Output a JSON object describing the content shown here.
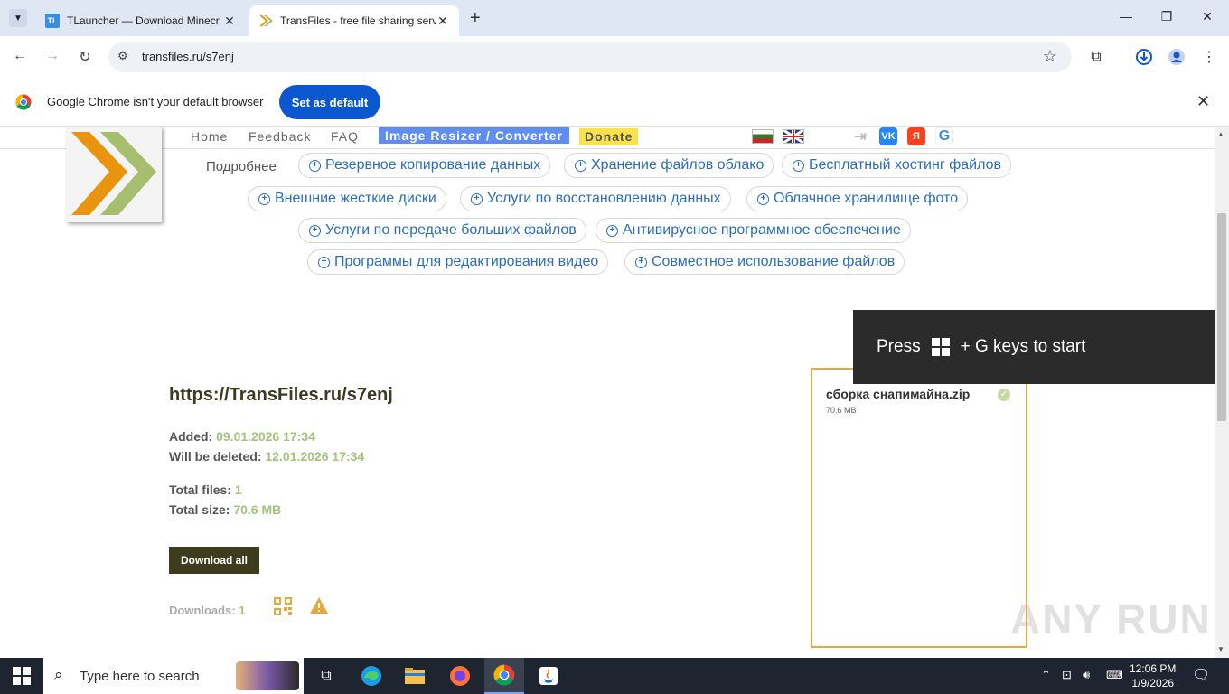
{
  "browser": {
    "tabs": [
      {
        "title": "TLauncher — Download Minecr",
        "active": false
      },
      {
        "title": "TransFiles - free file sharing serv",
        "active": true
      }
    ],
    "url": "transfiles.ru/s7enj"
  },
  "infobar": {
    "message": "Google Chrome isn't your default browser",
    "button": "Set as default"
  },
  "site": {
    "nav": {
      "home": "Home",
      "feedback": "Feedback",
      "faq": "FAQ",
      "resizer": "Image Resizer / Converter",
      "donate": "Donate"
    },
    "social": {
      "vk": "VK",
      "yandex": "Я",
      "google": "G"
    },
    "more_label": "Подробнее",
    "pills": [
      "Резервное копирование данных",
      "Хранение файлов облако",
      "Бесплатный хостинг файлов",
      "Внешние жесткие диски",
      "Услуги по восстановлению данных",
      "Облачное хранилище фото",
      "Услуги по передаче больших файлов",
      "Антивирусное программное обеспечение",
      "Программы для редактирования видео",
      "Совместное использование файлов"
    ]
  },
  "gamebar": {
    "press": "Press",
    "rest": "+ G keys to start"
  },
  "share": {
    "url": "https://TransFiles.ru/s7enj",
    "added_label": "Added:",
    "added_value": "09.01.2026 17:34",
    "deleted_label": "Will be deleted:",
    "deleted_value": "12.01.2026 17:34",
    "total_files_label": "Total files:",
    "total_files_value": "1",
    "total_size_label": "Total size:",
    "total_size_value": "70.6 MB",
    "download_all": "Download all",
    "downloads_label": "Downloads:",
    "downloads_value": "1"
  },
  "file": {
    "name": "сборка снапимайна.zip",
    "size": "70.6 MB"
  },
  "watermark": "ANY RUN",
  "taskbar": {
    "search_placeholder": "Type here to search",
    "time": "12:06 PM",
    "date": "1/9/2026"
  },
  "colors": {
    "accent": "#0b57d0",
    "value_green": "#a5c17a",
    "file_border": "#e8a93c",
    "link_blue": "#2a6ebb"
  }
}
